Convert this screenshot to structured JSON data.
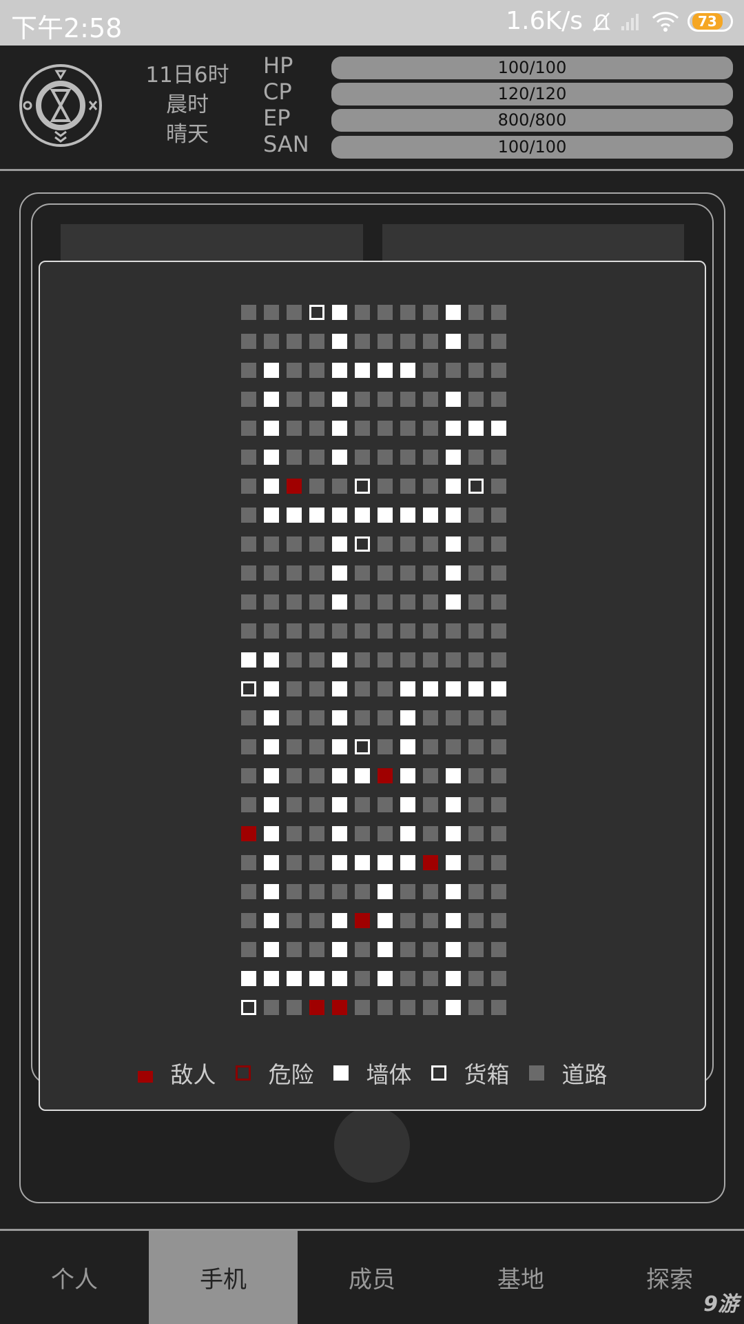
{
  "status_bar": {
    "time": "下午2:58",
    "net_speed": "1.6K/s",
    "battery": "73",
    "icons": [
      "bell-muted-icon",
      "signal-icon",
      "wifi-icon",
      "battery-icon"
    ]
  },
  "header": {
    "date": "11日6时",
    "period": "晨时",
    "weather": "晴天",
    "stats": [
      {
        "label": "HP",
        "value": "100/100",
        "fraction": 1.0
      },
      {
        "label": "CP",
        "value": "120/120",
        "fraction": 1.0
      },
      {
        "label": "EP",
        "value": "800/800",
        "fraction": 1.0
      },
      {
        "label": "SAN",
        "value": "100/100",
        "fraction": 1.0
      }
    ]
  },
  "map": {
    "legend_key": {
      "R": "road",
      "W": "wall",
      "C": "crate",
      "E": "enemy"
    },
    "rows": [
      "RRRCWRRRRWRR",
      "RRRRWRRRRWRR",
      "RWRRWWWWRRRR",
      "RWRRWRRRRWRR",
      "RWRRWRRRRWWW",
      "RWRRWRRRRWRR",
      "RWERRCRRRWCR",
      "RWWWWWWWWWRR",
      "RRRRWCRRRWRR",
      "RRRRWRRRRWRR",
      "RRRRWRRRRWRR",
      "RRRRRRRRRRRR",
      "WWRRWRRRRRRR",
      "CWRRWRRWWWWW",
      "RWRRWRRWRRRR",
      "RWRRWCRWRRRR",
      "RWRRWWEWRWRR",
      "RWRRWRRWRWRR",
      "EWRRWRRWRWRR",
      "RWRRWWWWEWRR",
      "RWRRRRWRRWRR",
      "RWRRWEWRRWRR",
      "RWRRWRWRRWRR",
      "WWWWWRWRRWRR",
      "CRREERRRRWRR"
    ],
    "colors": {
      "enemy": "#a00000",
      "danger": "#8a0000",
      "wall": "#ffffff",
      "road": "#6a6a6a"
    },
    "legend": [
      {
        "type": "enemy",
        "label": "敌人"
      },
      {
        "type": "danger",
        "label": "危险"
      },
      {
        "type": "wall",
        "label": "墙体"
      },
      {
        "type": "crate",
        "label": "货箱"
      },
      {
        "type": "road",
        "label": "道路"
      }
    ]
  },
  "nav": {
    "active": 1,
    "tabs": [
      {
        "label": "个人"
      },
      {
        "label": "手机"
      },
      {
        "label": "成员"
      },
      {
        "label": "基地"
      },
      {
        "label": "探索"
      }
    ]
  },
  "watermark": "九游"
}
